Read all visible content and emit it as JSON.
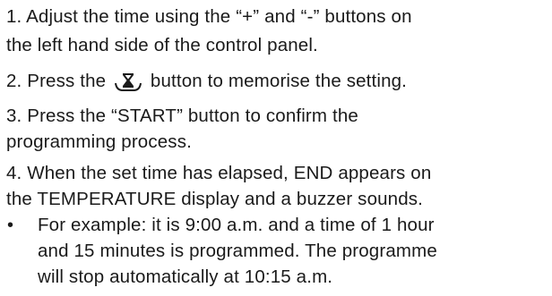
{
  "steps": [
    {
      "lines": [
        "1. Adjust the time using the “+” and “-” buttons on",
        "the left hand side of the control panel."
      ]
    },
    {
      "before_icon": "2. Press the",
      "icon": "hourglass-timer-icon",
      "after_icon": "button to memorise the setting."
    },
    {
      "lines": [
        "3. Press the “START” button to confirm the",
        "programming process."
      ]
    },
    {
      "lines": [
        "4. When the set time has elapsed, END appears on",
        "the TEMPERATURE display and a buzzer sounds."
      ]
    }
  ],
  "example": {
    "bullet": "•",
    "lines": [
      "For example: it is 9:00 a.m. and a time of 1 hour",
      "and 15 minutes is programmed. The programme",
      "will stop automatically at 10:15 a.m."
    ]
  },
  "colors": {
    "text": "#1a1a1a"
  }
}
